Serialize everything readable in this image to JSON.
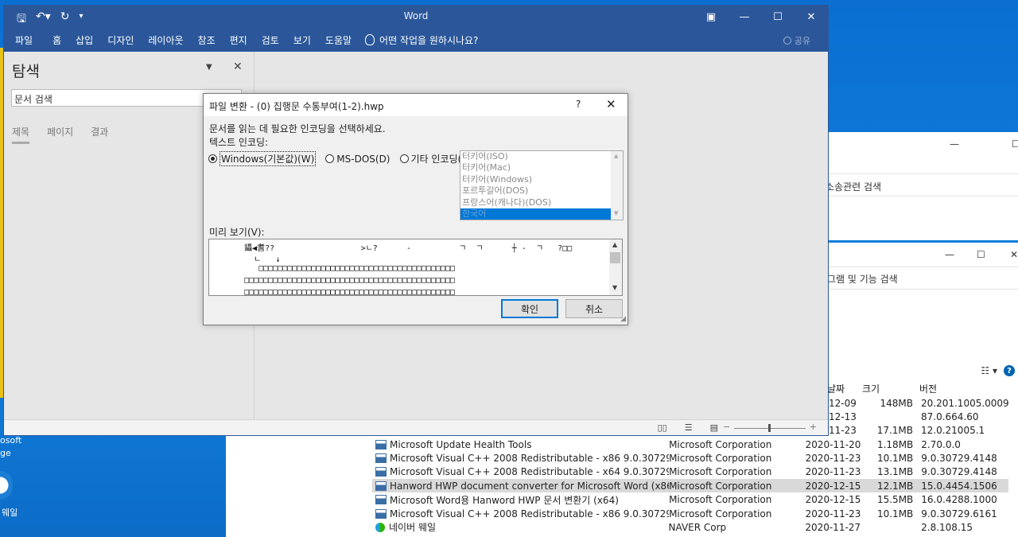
{
  "desktop": {
    "icon_label_1": "osoft",
    "icon_label_2": "ge",
    "icon_label_3": "웨일"
  },
  "bg_windows": {
    "win1_search": "소송관련 검색",
    "win2_search": "그램 및 기능 검색"
  },
  "programs": {
    "header": {
      "date": "날짜",
      "size": "크기",
      "version": "버전"
    },
    "top_rows": [
      {
        "date": "12-09",
        "size": "148MB",
        "version": "20.201.1005.0009"
      },
      {
        "date": "12-13",
        "size": "",
        "version": "87.0.664.60"
      },
      {
        "date": "11-23",
        "size": "17.1MB",
        "version": "12.0.21005.1"
      }
    ],
    "rows": [
      {
        "name": "Microsoft Update Health Tools",
        "publisher": "Microsoft Corporation",
        "date": "2020-11-20",
        "size": "1.18MB",
        "version": "2.70.0.0"
      },
      {
        "name": "Microsoft Visual C++ 2008 Redistributable - x86 9.0.30729.4148",
        "publisher": "Microsoft Corporation",
        "date": "2020-11-23",
        "size": "10.1MB",
        "version": "9.0.30729.4148"
      },
      {
        "name": "Microsoft Visual C++ 2008 Redistributable - x64 9.0.30729.4148",
        "publisher": "Microsoft Corporation",
        "date": "2020-11-23",
        "size": "13.1MB",
        "version": "9.0.30729.4148"
      },
      {
        "name": "Hanword HWP document converter for Microsoft Word (x86)",
        "publisher": "Microsoft Corporation",
        "date": "2020-12-15",
        "size": "12.1MB",
        "version": "15.0.4454.1506"
      },
      {
        "name": "Microsoft Word용 Hanword HWP 문서 변환기 (x64)",
        "publisher": "Microsoft Corporation",
        "date": "2020-12-15",
        "size": "15.5MB",
        "version": "16.0.4288.1000"
      },
      {
        "name": "Microsoft Visual C++ 2008 Redistributable - x86 9.0.30729.6161",
        "publisher": "Microsoft Corporation",
        "date": "2020-11-23",
        "size": "10.1MB",
        "version": "9.0.30729.6161"
      },
      {
        "name": "네이버 웨일",
        "publisher": "NAVER Corp",
        "date": "2020-11-27",
        "size": "",
        "version": "2.8.108.15"
      }
    ]
  },
  "word": {
    "app_title": "Word",
    "ribbon_tabs": [
      "파일",
      "홈",
      "삽입",
      "디자인",
      "레이아웃",
      "참조",
      "편지",
      "검토",
      "보기",
      "도움말"
    ],
    "tell_me": "어떤 작업을 원하시나요?",
    "share": "공유",
    "nav": {
      "title": "탐색",
      "search_value": "문서 검색",
      "tabs": [
        "제목",
        "페이지",
        "결과"
      ]
    }
  },
  "dialog": {
    "title": "파일 변환 - (0) 집행문 수통부여(1-2).hwp",
    "help": "?",
    "instruction": "문서를 읽는 데 필요한 인코딩을 선택하세요.",
    "encoding_label": "텍스트 인코딩:",
    "radios": [
      "Windows(기본값)(W)",
      "MS-DOS(D)",
      "기타 인코딩(O):"
    ],
    "encodings": [
      "터키어(ISO)",
      "터키어(Mac)",
      "터키어(Windows)",
      "포르투갈어(DOS)",
      "프랑스어(캐나다)(DOS)",
      "한국어"
    ],
    "preview_label": "미리 보기(V):",
    "preview_lines": [
      "       鑷◀耆??                  >ㄴ?      -          ㄱ  ㄱ      ┼ -  ㄱ   ?□□",
      "         ㄴ   ↓",
      "          □□□□□□□□□□□□□□□□□□□□□□□□□□□□□□□□□□□□□□□□□",
      "       □□□□□□□□□□□□□□□□□□□□□□□□□□□□□□□□□□□□□□□□□□□□",
      "       □□□□□□□□□□□□□□□□□□□□□□□□□□□□□□□□□□□□□□□□□□□□"
    ],
    "ok": "확인",
    "cancel": "취소"
  },
  "colors": {
    "word_blue": "#2b579a",
    "accent": "#0078d7"
  }
}
